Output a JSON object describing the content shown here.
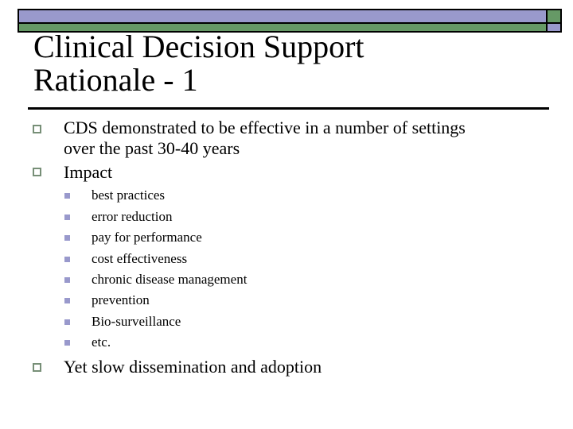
{
  "slide": {
    "title_line1": "Clinical Decision Support",
    "title_line2": "Rationale - 1",
    "colors": {
      "banner_purple": "#9999cc",
      "banner_green": "#669966",
      "bullet_outline": "#778f77",
      "subbullet_fill": "#9999cc"
    },
    "bullets": [
      {
        "line1": "CDS demonstrated to be effective in a number of settings",
        "line2": "over the past 30-40 years"
      },
      {
        "line1": "Impact",
        "sub_items": [
          "best practices",
          "error reduction",
          "pay for performance",
          "cost effectiveness",
          "chronic disease management",
          "prevention",
          "Bio-surveillance",
          "etc."
        ]
      },
      {
        "line1": "Yet slow dissemination and adoption"
      }
    ]
  }
}
